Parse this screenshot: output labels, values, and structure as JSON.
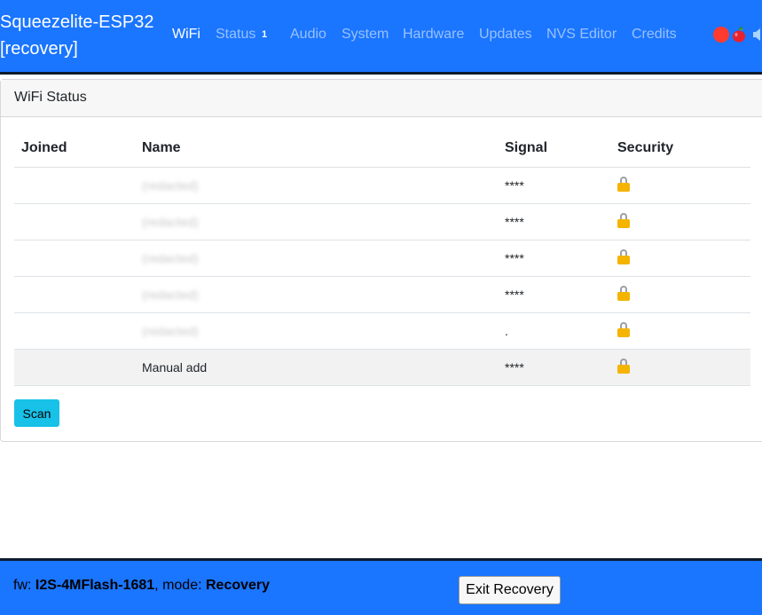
{
  "brand": {
    "line1": "Squeezelite-ESP32",
    "line2": "[recovery]"
  },
  "nav": {
    "items": [
      {
        "label": "WiFi",
        "active": true
      },
      {
        "label": "Status"
      },
      {
        "label": "Audio"
      },
      {
        "label": "System"
      },
      {
        "label": "Hardware"
      },
      {
        "label": "Updates"
      },
      {
        "label": "NVS Editor"
      },
      {
        "label": "Credits"
      }
    ],
    "status_badge": "1"
  },
  "status_icons": [
    "red-status-dot-icon",
    "apple-icon",
    "speaker-icon"
  ],
  "card": {
    "title": "WiFi Status",
    "columns": [
      "Joined",
      "Name",
      "Signal",
      "Security"
    ],
    "rows": [
      {
        "joined": "",
        "name": "(redacted)",
        "signal": "****",
        "security": "lock-icon"
      },
      {
        "joined": "",
        "name": "(redacted)",
        "signal": "****",
        "security": "lock-icon"
      },
      {
        "joined": "",
        "name": "(redacted)",
        "signal": "****",
        "security": "lock-icon"
      },
      {
        "joined": "",
        "name": "(redacted)",
        "signal": "****",
        "security": "lock-icon"
      },
      {
        "joined": "",
        "name": "(redacted)",
        "signal": ".",
        "security": "lock-icon"
      },
      {
        "joined": "",
        "name": "Manual add",
        "signal": "****",
        "security": "lock-icon"
      }
    ],
    "scan_label": "Scan"
  },
  "footer": {
    "fw_label": "fw: ",
    "fw_value": "I2S-4MFlash-1681",
    "mode_label": ", mode: ",
    "mode_value": "Recovery",
    "exit_label": "Exit Recovery"
  },
  "colors": {
    "navbar": "#1a75ff",
    "scan_button": "#17c1e8",
    "lock": "#f4b400"
  }
}
